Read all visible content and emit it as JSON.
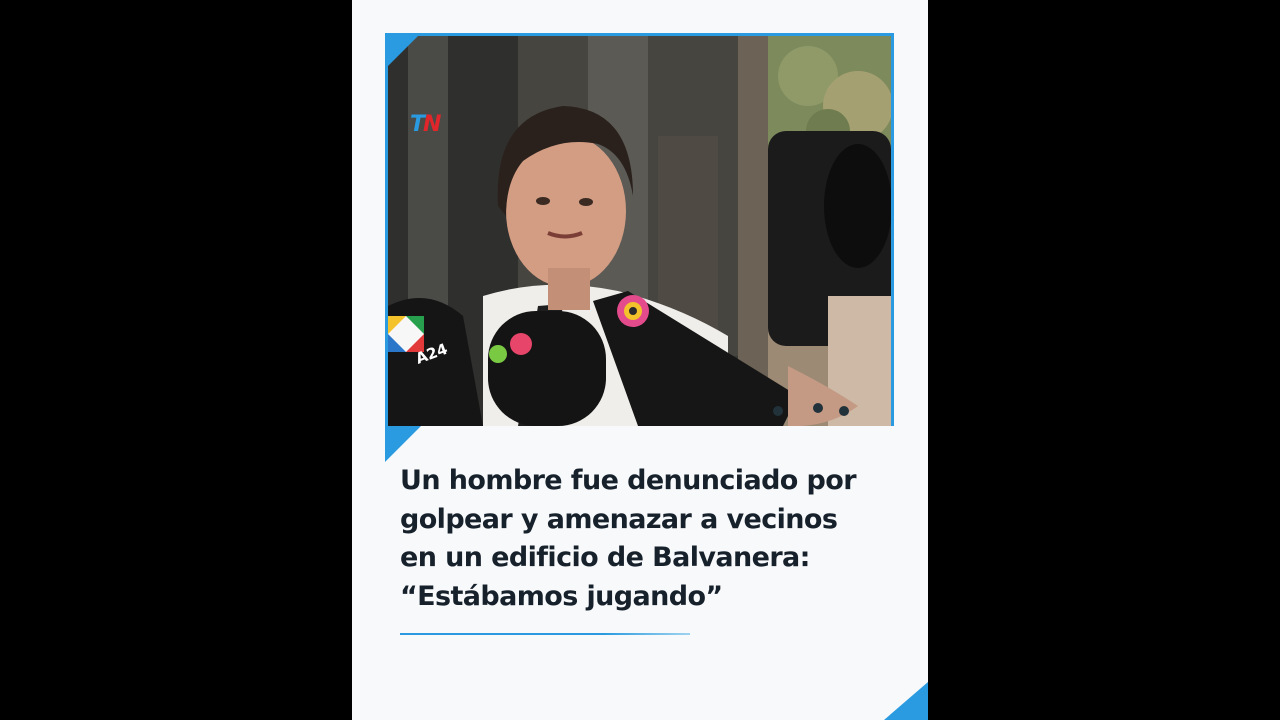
{
  "video": {
    "channel_logo": "TN",
    "headline_lines": [
      "Un hombre fue denunciado por",
      "golpear y amenazar a vecinos",
      "en un edificio de Balvanera:",
      "“Estábamos jugando”"
    ],
    "mic_labels": {
      "a24": "A24"
    }
  },
  "colors": {
    "accent": "#2a9be0",
    "card_background": "#f7f9fb",
    "text": "#17212b",
    "logo_red": "#e0262b"
  }
}
